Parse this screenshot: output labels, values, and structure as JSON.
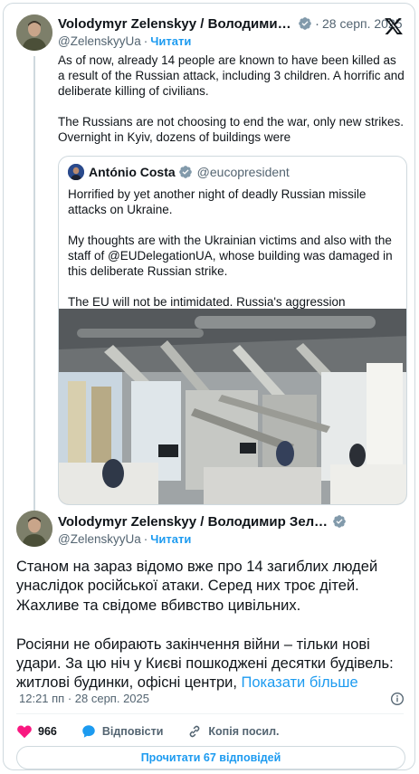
{
  "parent_tweet": {
    "author_name": "Volodymyr Zelenskyy / Володимир Зелен...",
    "handle": "@ZelenskyyUa",
    "follow_label": "Читати",
    "separator": "·",
    "date": "28 серп. 2025",
    "text": "As of now, already 14 people are known to have been killed as a result of the Russian attack, including 3 children. A horrific and deliberate killing of civilians.\n\nThe Russians are not choosing to end the war, only new strikes. Overnight in Kyiv, dozens of buildings were"
  },
  "quoted_tweet": {
    "author_name": "António Costa",
    "handle": "@eucopresident",
    "text": "Horrified by yet another night of deadly Russian missile attacks on Ukraine.\n\nMy thoughts are with the Ukrainian victims and also with the staff of @EUDelegationUA, whose building was damaged in this deliberate Russian strike.\n\nThe EU will not be intimidated. Russia's aggression",
    "image_icon": "damaged-office-photo"
  },
  "main_tweet": {
    "author_name": "Volodymyr Zelenskyy / Володимир Зеленський",
    "handle": "@ZelenskyyUa",
    "follow_label": "Читати",
    "separator": "·",
    "text": "Станом на зараз відомо вже про 14 загиблих людей унаслідок російської атаки. Серед них троє дітей. Жахливе та свідоме вбивство цивільних.\n\nРосіяни не обирають закінчення війни – тільки нові удари. За цю ніч у Києві пошкоджені десятки будівель: житлові будинки, офісні центри, ",
    "show_more": "Показати більше",
    "timestamp": "12:21 пп · 28 серп. 2025"
  },
  "actions": {
    "likes": "966",
    "reply_label": "Відповісти",
    "copy_label": "Копія посил."
  },
  "read_replies_label": "Прочитати 67 відповідей",
  "colors": {
    "accent": "#1d9bf0",
    "like": "#f91880",
    "verified": "#829aab",
    "border": "#cfd9de",
    "muted": "#536471"
  }
}
